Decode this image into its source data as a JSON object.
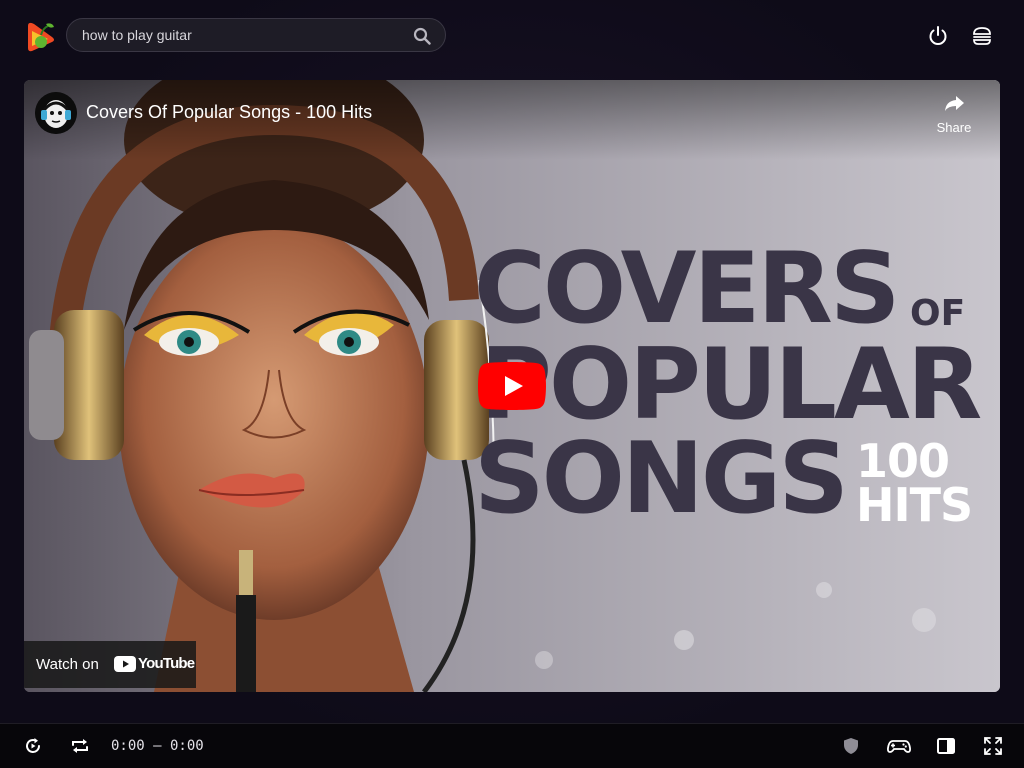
{
  "search": {
    "value": "how to play guitar",
    "icon": "search-icon"
  },
  "header_icons": [
    "power-icon",
    "menu-icon"
  ],
  "video": {
    "title": "Covers Of Popular Songs - 100 Hits",
    "share_label": "Share",
    "watch_on_label": "Watch on",
    "youtube_label": "YouTube",
    "thumbnail_text": {
      "line1": "COVERS",
      "line1_small": "OF",
      "line2": "POPULAR",
      "line3": "SONGS",
      "badge_line1": "100",
      "badge_line2": "HITS"
    },
    "play_button_color": "#ff0000"
  },
  "player": {
    "time": "0:00 – 0:00",
    "left_icons": [
      "autoplay-icon",
      "repeat-icon"
    ],
    "right_icons": [
      "shield-icon",
      "gamepad-icon",
      "sidebar-toggle-icon",
      "fullscreen-icon"
    ]
  },
  "colors": {
    "background": "#0e0b18",
    "accent": "#ff0000",
    "thumbnail_text": "#3a3547"
  }
}
